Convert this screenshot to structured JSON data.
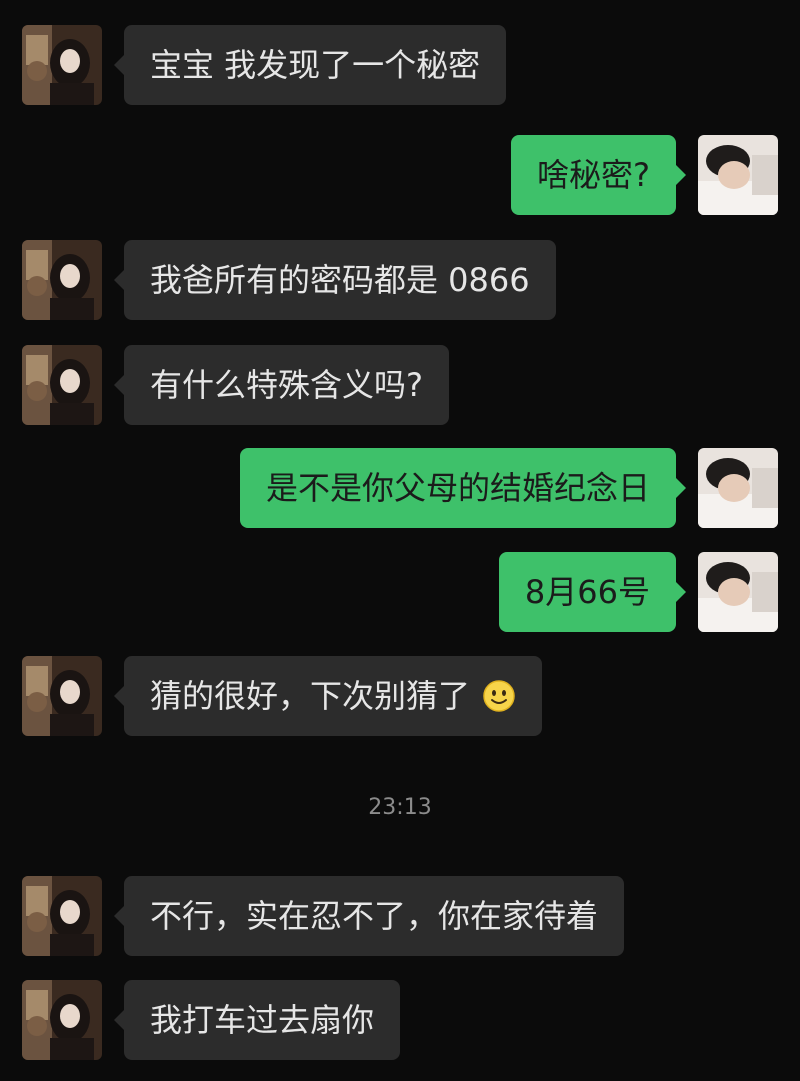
{
  "messages": [
    {
      "side": "left",
      "text": "宝宝 我发现了一个秘密"
    },
    {
      "side": "right",
      "text": "啥秘密?"
    },
    {
      "side": "left",
      "text": "我爸所有的密码都是 0866"
    },
    {
      "side": "left",
      "text": "有什么特殊含义吗?"
    },
    {
      "side": "right",
      "text": "是不是你父母的结婚纪念日"
    },
    {
      "side": "right",
      "text": "8月66号"
    },
    {
      "side": "left",
      "text": "猜的很好，下次别猜了",
      "emoji": "smile-emoji"
    },
    {
      "side": "left",
      "text": "不行，实在忍不了，你在家待着"
    },
    {
      "side": "left",
      "text": "我打车过去扇你"
    }
  ],
  "timestamp": "23:13",
  "colors": {
    "background": "#0b0b0b",
    "incoming_bubble": "#2c2c2c",
    "outgoing_bubble": "#3ec16a"
  }
}
